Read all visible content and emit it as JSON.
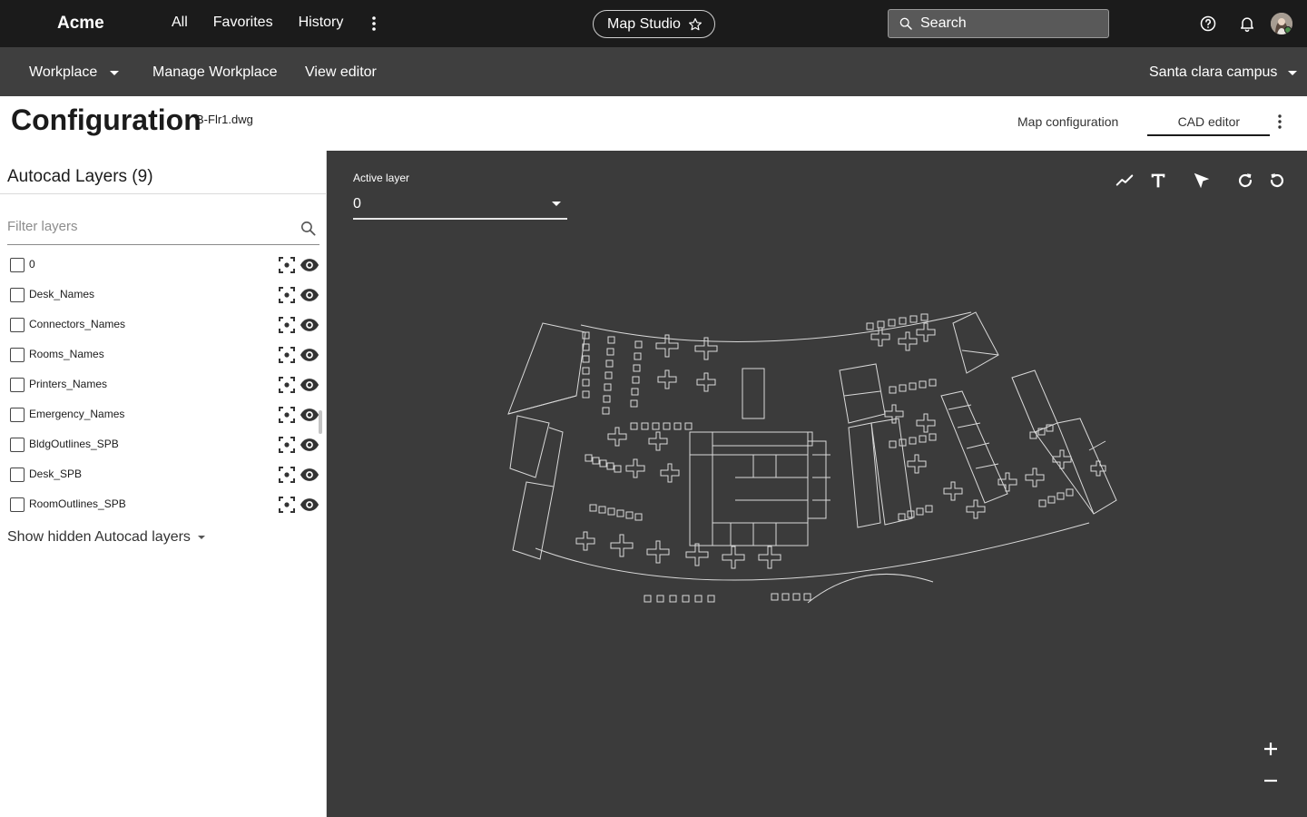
{
  "topbar": {
    "brand": "Acme",
    "nav": [
      "All",
      "Favorites",
      "History"
    ],
    "app_pill": "Map Studio",
    "search_placeholder": "Search",
    "icons": [
      "more-vertical-icon",
      "star-icon",
      "search-icon",
      "help-icon",
      "bell-icon",
      "avatar"
    ]
  },
  "subbar": {
    "workplace": "Workplace",
    "manage": "Manage Workplace",
    "view_editor": "View editor",
    "campus": "Santa clara campus"
  },
  "header": {
    "title": "Configuration",
    "file": "B-Flr1.dwg",
    "tabs": [
      "Map configuration",
      "CAD editor"
    ],
    "active_tab": "CAD editor"
  },
  "layers_panel": {
    "title": "Autocad Layers (9)",
    "filter_placeholder": "Filter layers",
    "layers": [
      {
        "name": "0",
        "checked": false,
        "visible": true
      },
      {
        "name": "Desk_Names",
        "checked": false,
        "visible": true
      },
      {
        "name": "Connectors_Names",
        "checked": false,
        "visible": true
      },
      {
        "name": "Rooms_Names",
        "checked": false,
        "visible": true
      },
      {
        "name": "Printers_Names",
        "checked": false,
        "visible": true
      },
      {
        "name": "Emergency_Names",
        "checked": false,
        "visible": true
      },
      {
        "name": "BldgOutlines_SPB",
        "checked": false,
        "visible": true
      },
      {
        "name": "Desk_SPB",
        "checked": false,
        "visible": true
      },
      {
        "name": "RoomOutlines_SPB",
        "checked": false,
        "visible": true
      }
    ],
    "show_hidden": "Show hidden Autocad layers"
  },
  "canvas": {
    "active_layer_label": "Active layer",
    "active_layer_value": "0",
    "tools": [
      "polyline-icon",
      "text-tool-icon",
      "select-pointer-icon",
      "redo-icon",
      "undo-icon"
    ],
    "zoom_controls": [
      "zoom-in-icon",
      "zoom-out-icon"
    ]
  },
  "colors": {
    "topbar_bg": "#1b1b1b",
    "subbar_bg": "#3f3f3f",
    "canvas_bg": "#3b3b3b",
    "plan_stroke": "#d9d9d9"
  }
}
